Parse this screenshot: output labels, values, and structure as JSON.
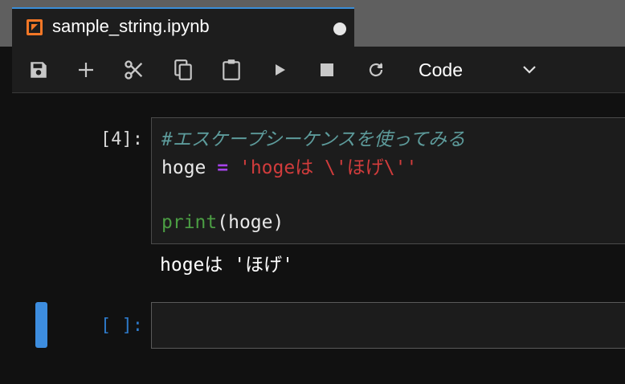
{
  "tab": {
    "title": "sample_string.ipynb",
    "icon": "notebook-icon",
    "dirty_icon": "unsaved-dot-icon"
  },
  "toolbar": {
    "buttons": [
      {
        "name": "save-button",
        "icon": "save-icon"
      },
      {
        "name": "insert-cell-button",
        "icon": "plus-icon"
      },
      {
        "name": "cut-button",
        "icon": "scissors-icon"
      },
      {
        "name": "copy-button",
        "icon": "copy-icon"
      },
      {
        "name": "paste-button",
        "icon": "clipboard-icon"
      },
      {
        "name": "run-button",
        "icon": "play-icon"
      },
      {
        "name": "interrupt-button",
        "icon": "stop-icon"
      },
      {
        "name": "restart-button",
        "icon": "restart-icon"
      }
    ],
    "cell_type": "Code",
    "cell_type_icon": "chevron-down-icon"
  },
  "cells": [
    {
      "prompt": "[4]:",
      "lines": [
        {
          "comment": "#エスケープシーケンスを使ってみる"
        },
        {
          "var": "hoge",
          "op": "=",
          "str": "'hogeは \\'ほげ\\''"
        },
        {},
        {
          "builtin": "print",
          "rest": "(hoge)"
        }
      ],
      "output": "hogeは 'ほげ'"
    },
    {
      "prompt": "[ ]:",
      "active": true
    }
  ],
  "colors": {
    "accent": "#3a8ed8",
    "active_cell": "#3d8ddf",
    "comment": "#5d9b9b",
    "operator": "#a542e9",
    "string": "#d13c3c",
    "builtin": "#4b9d43",
    "notebook_icon": "#f37726"
  }
}
